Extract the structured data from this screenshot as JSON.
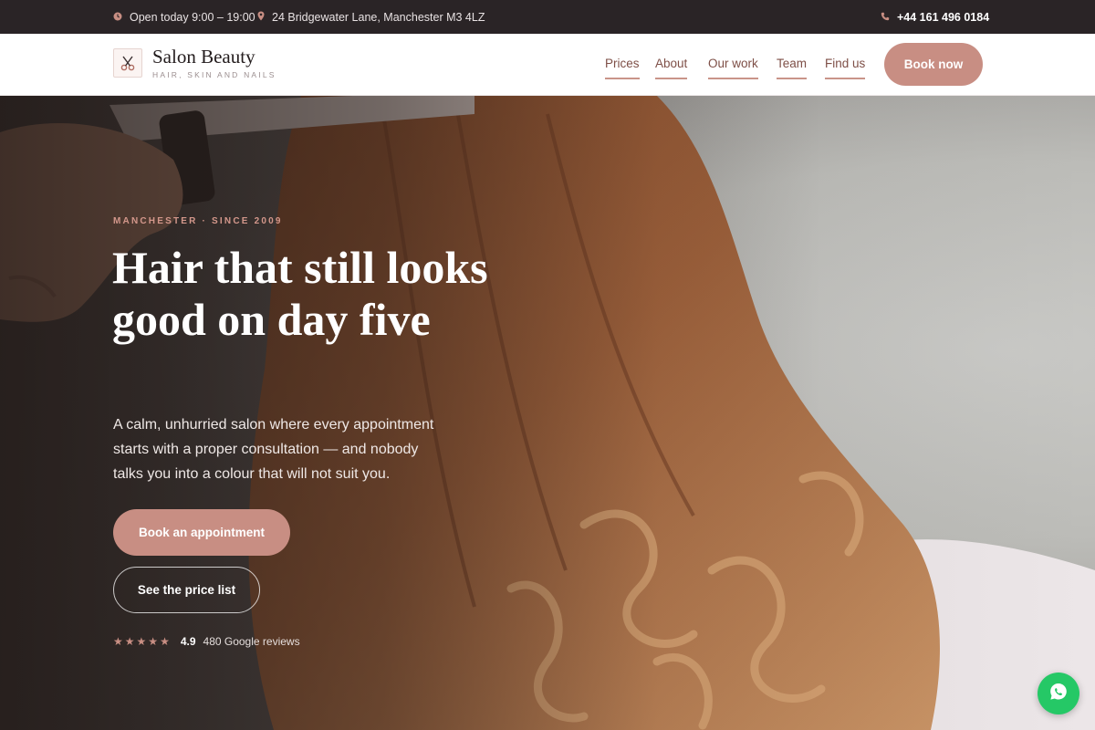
{
  "topbar": {
    "hours": "Open today 9:00 – 19:00",
    "address": "24 Bridgewater Lane, Manchester M3 4LZ",
    "phone": "+44 161 496 0184",
    "icons": [
      "clock-icon",
      "map-pin-icon",
      "phone-icon"
    ]
  },
  "header": {
    "brand_name": "Salon Beauty",
    "brand_tagline": "HAIR, SKIN AND NAILS",
    "logo_icon": "scissors-icon",
    "nav": [
      "Prices",
      "About",
      "Our work",
      "Team",
      "Find us"
    ],
    "book_label": "Book now"
  },
  "hero": {
    "eyebrow": "MANCHESTER · SINCE 2009",
    "headline": "Hair that still looks good on day five",
    "subtext": "A calm, unhurried salon where every appointment starts with a proper consultation — and nobody talks you into a colour that will not suit you.",
    "primary_button": "Book an appointment",
    "secondary_button": "See the price list",
    "rating_value": "4.9",
    "rating_stars": 5,
    "reviews_text": "480 Google reviews"
  },
  "chat": {
    "icon": "whatsapp-icon"
  },
  "colors": {
    "accent": "#c88e83",
    "topbar_bg": "#2a2426",
    "nav_text": "#7e4f47",
    "chat_green": "#25c866"
  }
}
